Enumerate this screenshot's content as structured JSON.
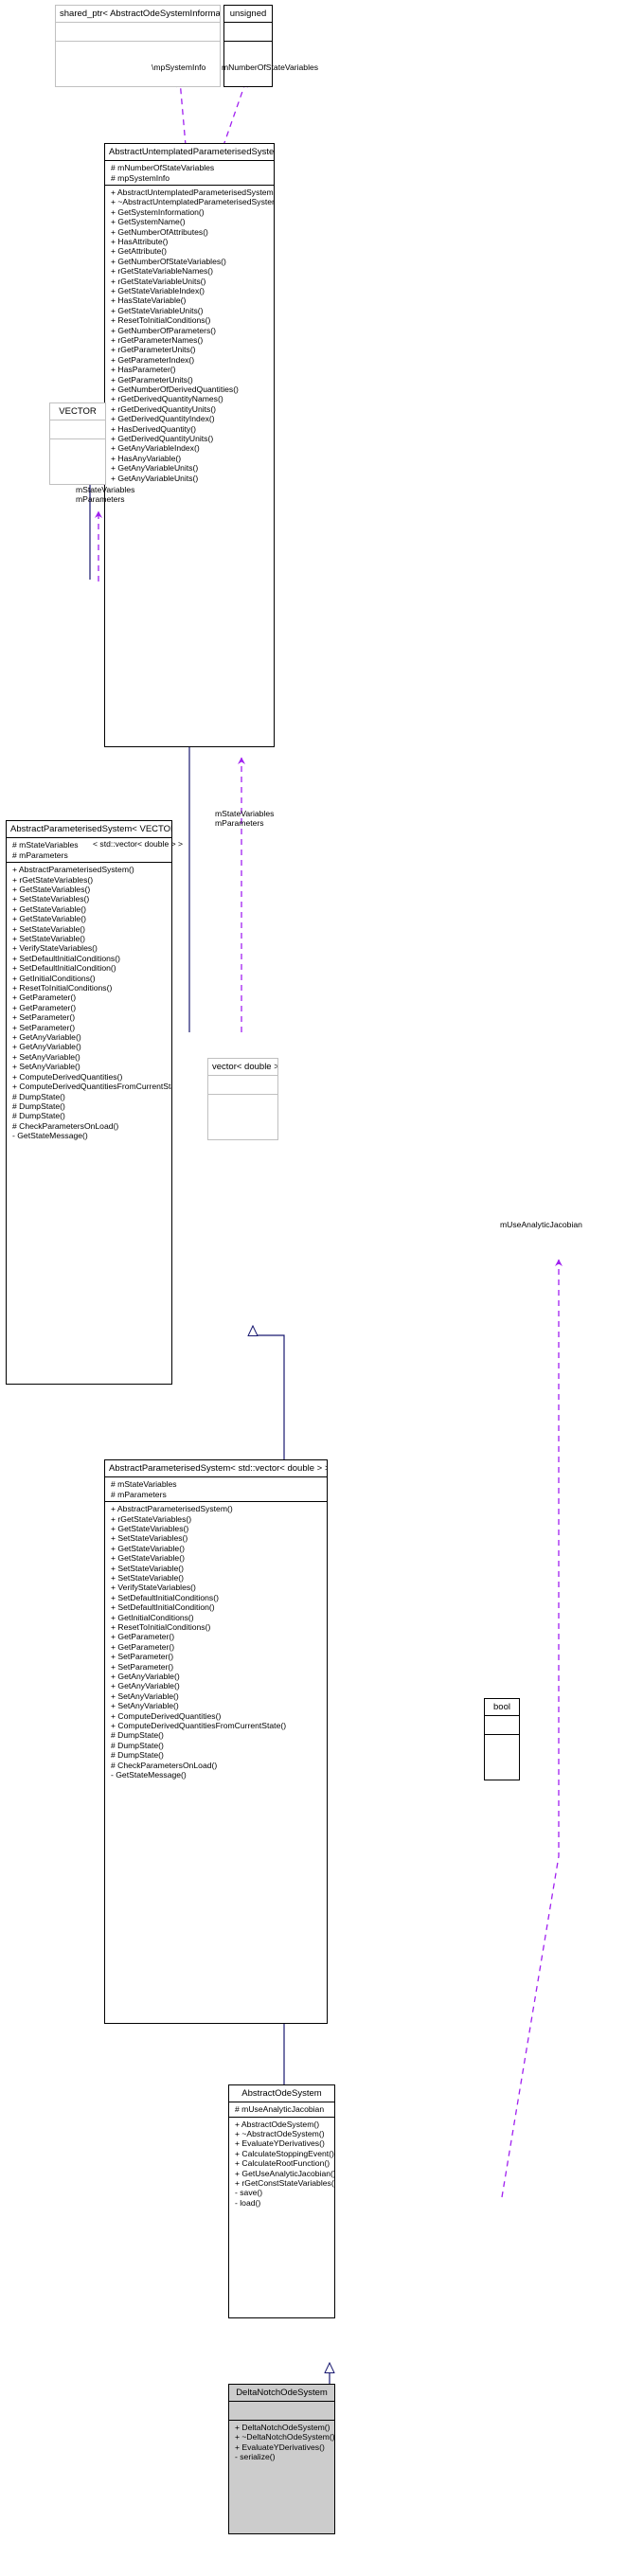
{
  "diagram": {
    "kind": "uml-inheritance-collaboration-diagram",
    "colors": {
      "inheritance_arrow": "#191970",
      "usage_arrow": "#a020f0",
      "template_arrow": "#ffa500",
      "highlight_fill": "#cccccc",
      "node_border": "#000000",
      "thin_node_border": "#c0c0c0"
    },
    "edge_labels": [
      {
        "id": "mpSystemInfo",
        "text": "\\mpSystemInfo"
      },
      {
        "id": "mNumberOfStateVariables",
        "text": "mNumberOfStateVariables"
      },
      {
        "id": "mStateVariables_mParameters_vector",
        "line1": "mStateVariables",
        "line2": "mParameters"
      },
      {
        "id": "mStateVariables_mParameters_stdvector",
        "line1": "mStateVariables",
        "line2": "mParameters"
      },
      {
        "id": "template_binding",
        "text": "< std::vector< double > >"
      },
      {
        "id": "mUseAnalyticJacobian",
        "text": "mUseAnalyticJacobian"
      }
    ],
    "nodes": [
      {
        "id": "shared_ptr",
        "title": "shared_ptr< AbstractOdeSystemInformation >",
        "attrs": [],
        "ops": []
      },
      {
        "id": "unsigned",
        "title": "unsigned",
        "attrs": [],
        "ops": []
      },
      {
        "id": "vector_double",
        "title": "vector< double >",
        "attrs": [],
        "ops": []
      },
      {
        "id": "VECTOR",
        "title": "VECTOR",
        "attrs": [],
        "ops": []
      },
      {
        "id": "bool",
        "title": "bool",
        "attrs": [],
        "ops": []
      },
      {
        "id": "AbstractUntemplatedParameterisedSystem",
        "title": "AbstractUntemplatedParameterisedSystem",
        "attrs": [
          "# mNumberOfStateVariables",
          "# mpSystemInfo"
        ],
        "ops": [
          "+ AbstractUntemplatedParameterisedSystem()",
          "+ ~AbstractUntemplatedParameterisedSystem()",
          "+ GetSystemInformation()",
          "+ GetSystemName()",
          "+ GetNumberOfAttributes()",
          "+ HasAttribute()",
          "+ GetAttribute()",
          "+ GetNumberOfStateVariables()",
          "+ rGetStateVariableNames()",
          "+ rGetStateVariableUnits()",
          "+ GetStateVariableIndex()",
          "+ HasStateVariable()",
          "+ GetStateVariableUnits()",
          "+ ResetToInitialConditions()",
          "+ GetNumberOfParameters()",
          "+ rGetParameterNames()",
          "+ rGetParameterUnits()",
          "+ GetParameterIndex()",
          "+ HasParameter()",
          "+ GetParameterUnits()",
          "+ GetNumberOfDerivedQuantities()",
          "+ rGetDerivedQuantityNames()",
          "+ rGetDerivedQuantityUnits()",
          "+ GetDerivedQuantityIndex()",
          "+ HasDerivedQuantity()",
          "+ GetDerivedQuantityUnits()",
          "+ GetAnyVariableIndex()",
          "+ HasAnyVariable()",
          "+ GetAnyVariableUnits()",
          "+ GetAnyVariableUnits()"
        ]
      },
      {
        "id": "AbstractParameterisedSystem_VECTOR",
        "title": "AbstractParameterisedSystem< VECTOR >",
        "attrs": [
          "# mStateVariables",
          "# mParameters"
        ],
        "ops": [
          "+ AbstractParameterisedSystem()",
          "+ rGetStateVariables()",
          "+ GetStateVariables()",
          "+ SetStateVariables()",
          "+ GetStateVariable()",
          "+ GetStateVariable()",
          "+ SetStateVariable()",
          "+ SetStateVariable()",
          "+ VerifyStateVariables()",
          "+ SetDefaultInitialConditions()",
          "+ SetDefaultInitialCondition()",
          "+ GetInitialConditions()",
          "+ ResetToInitialConditions()",
          "+ GetParameter()",
          "+ GetParameter()",
          "+ SetParameter()",
          "+ SetParameter()",
          "+ GetAnyVariable()",
          "+ GetAnyVariable()",
          "+ SetAnyVariable()",
          "+ SetAnyVariable()",
          "+ ComputeDerivedQuantities()",
          "+ ComputeDerivedQuantitiesFromCurrentState()",
          "# DumpState()",
          "# DumpState()",
          "# DumpState()",
          "# CheckParametersOnLoad()",
          "- GetStateMessage()"
        ]
      },
      {
        "id": "AbstractParameterisedSystem_stdvector",
        "title": "AbstractParameterisedSystem< std::vector< double > >",
        "attrs": [
          "# mStateVariables",
          "# mParameters"
        ],
        "ops": [
          "+ AbstractParameterisedSystem()",
          "+ rGetStateVariables()",
          "+ GetStateVariables()",
          "+ SetStateVariables()",
          "+ GetStateVariable()",
          "+ GetStateVariable()",
          "+ SetStateVariable()",
          "+ SetStateVariable()",
          "+ VerifyStateVariables()",
          "+ SetDefaultInitialConditions()",
          "+ SetDefaultInitialCondition()",
          "+ GetInitialConditions()",
          "+ ResetToInitialConditions()",
          "+ GetParameter()",
          "+ GetParameter()",
          "+ SetParameter()",
          "+ SetParameter()",
          "+ GetAnyVariable()",
          "+ GetAnyVariable()",
          "+ SetAnyVariable()",
          "+ SetAnyVariable()",
          "+ ComputeDerivedQuantities()",
          "+ ComputeDerivedQuantitiesFromCurrentState()",
          "# DumpState()",
          "# DumpState()",
          "# DumpState()",
          "# CheckParametersOnLoad()",
          "- GetStateMessage()"
        ]
      },
      {
        "id": "AbstractOdeSystem",
        "title": "AbstractOdeSystem",
        "attrs": [
          "# mUseAnalyticJacobian"
        ],
        "ops": [
          "+ AbstractOdeSystem()",
          "+ ~AbstractOdeSystem()",
          "+ EvaluateYDerivatives()",
          "+ CalculateStoppingEvent()",
          "+ CalculateRootFunction()",
          "+ GetUseAnalyticJacobian()",
          "+ rGetConstStateVariables()",
          "- save()",
          "- load()"
        ]
      },
      {
        "id": "DeltaNotchOdeSystem",
        "title": "DeltaNotchOdeSystem",
        "attrs": [],
        "ops": [
          "+ DeltaNotchOdeSystem()",
          "+ ~DeltaNotchOdeSystem()",
          "+ EvaluateYDerivatives()",
          "- serialize()"
        ]
      }
    ]
  }
}
